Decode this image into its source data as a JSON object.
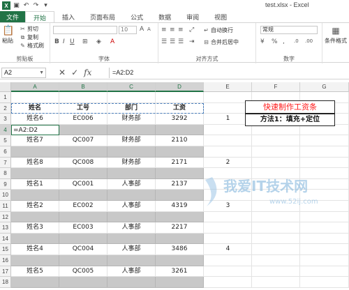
{
  "app": {
    "title": "test.xlsx - Excel",
    "logo_letter": "X"
  },
  "ribbon_tabs": [
    "文件",
    "开始",
    "插入",
    "页面布局",
    "公式",
    "数据",
    "审阅",
    "视图"
  ],
  "ribbon": {
    "clipboard": {
      "paste": "粘贴",
      "cut": "剪切",
      "copy": "复制",
      "format_painter": "格式刷",
      "group_label": "剪贴板"
    },
    "font": {
      "size": "10",
      "group_label": "字体"
    },
    "alignment": {
      "wrap_text": "自动换行",
      "merge_center": "合并后居中",
      "group_label": "对齐方式"
    },
    "number": {
      "format": "常规",
      "group_label": "数字"
    },
    "styles": {
      "conditional_format": "条件格式"
    }
  },
  "formula_bar": {
    "name_box": "A2",
    "formula": "=A2:D2"
  },
  "columns": [
    "A",
    "B",
    "C",
    "D",
    "E",
    "F",
    "G"
  ],
  "rows": [
    "1",
    "2",
    "3",
    "4",
    "5",
    "6",
    "7",
    "8",
    "9",
    "10",
    "11",
    "12",
    "13",
    "14",
    "15",
    "16",
    "17",
    "18"
  ],
  "sheet": {
    "headers": [
      "姓名",
      "工号",
      "部门",
      "工资"
    ],
    "records": [
      [
        "姓名6",
        "EC006",
        "财务部",
        "3292"
      ],
      [
        "姓名7",
        "QC007",
        "财务部",
        "2110"
      ],
      [
        "姓名8",
        "QC008",
        "财务部",
        "2171"
      ],
      [
        "姓名1",
        "QC001",
        "人事部",
        "2137"
      ],
      [
        "姓名2",
        "EC002",
        "人事部",
        "4319"
      ],
      [
        "姓名3",
        "EC003",
        "人事部",
        "2217"
      ],
      [
        "姓名4",
        "QC004",
        "人事部",
        "3486"
      ],
      [
        "姓名5",
        "QC005",
        "人事部",
        "3261"
      ]
    ],
    "active_cell_entry": "=A2:D2",
    "e_numbers": [
      "1",
      "2",
      "3",
      "4"
    ],
    "title_box": "快速制作工资条",
    "method_box": "方法1：填充+定位"
  },
  "watermark": {
    "text": "我爱IT技术网",
    "url": "www.52ij.com"
  },
  "colors": {
    "excel_green": "#217346",
    "selection_gray": "#c8c8c8",
    "marquee_blue": "#4a7ebb",
    "title_red": "#ff1a1a"
  }
}
